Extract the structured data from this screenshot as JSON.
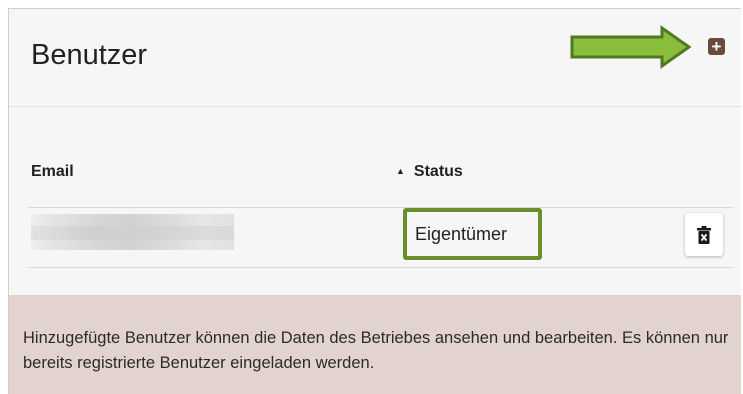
{
  "header": {
    "title": "Benutzer"
  },
  "table": {
    "columns": {
      "email": "Email",
      "status": "Status"
    },
    "sort_icon": "sort-up-icon",
    "rows": [
      {
        "email": "",
        "status": "Eigentümer"
      }
    ]
  },
  "info": {
    "text": "Hinzugefügte Benutzer können die Daten des Betriebes ansehen und bearbeiten. Es können nur bereits registrierte Benutzer eingeladen werden."
  },
  "colors": {
    "accent_brown": "#6a4a3c",
    "highlight_green": "#6a8e2a",
    "info_bg": "#e2d3cf"
  }
}
